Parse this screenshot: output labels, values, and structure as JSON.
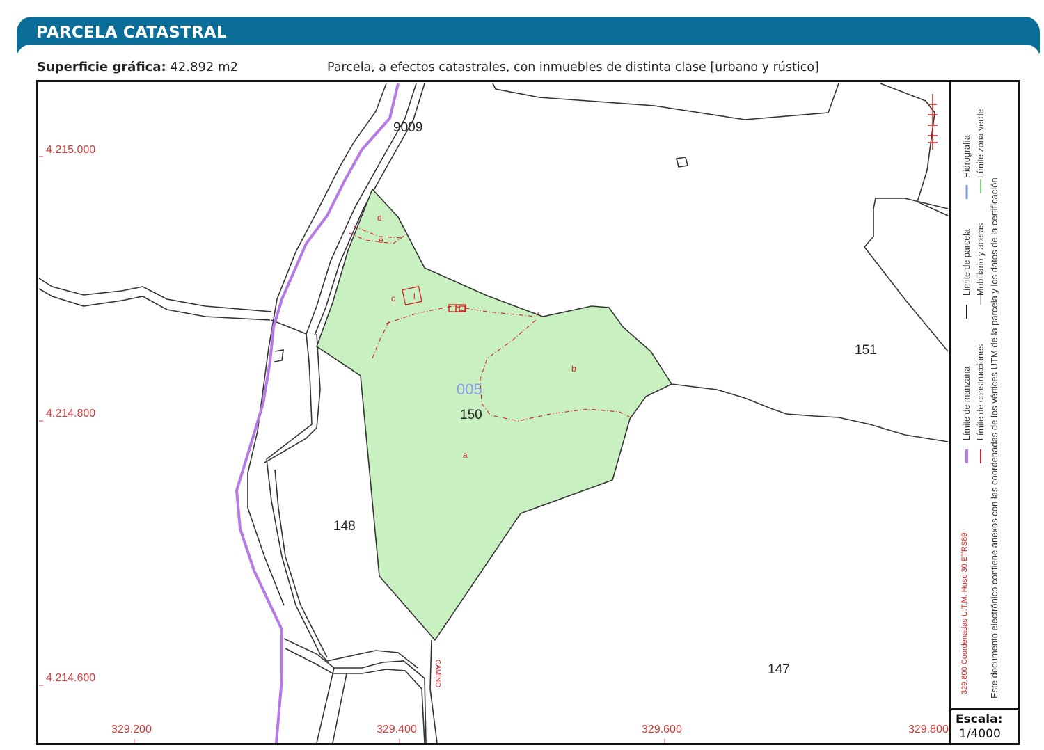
{
  "header": {
    "title": "PARCELA CATASTRAL"
  },
  "info": {
    "area_label": "Superficie gráfica:",
    "area_value": "42.892 m2",
    "description": "Parcela, a efectos catastrales, con inmuebles de distinta clase [urbano y rústico]"
  },
  "map": {
    "y_coords": [
      "4.215.000",
      "4.214.800",
      "4.214.600"
    ],
    "x_coords": [
      "329.200",
      "329.400",
      "329.600",
      "329.800"
    ],
    "parcels": {
      "main": "150",
      "west": "148",
      "south": "147",
      "east": "151",
      "road": "9009",
      "polygon": "005"
    },
    "subparcels": [
      "a",
      "b",
      "c",
      "d",
      "e"
    ],
    "construction_label": "l",
    "road_name": "CAMINO",
    "colors": {
      "parcel_fill": "#c8f0c0",
      "hydro": "#b679e8",
      "construction": "#d42020",
      "header": "#0a6e99",
      "polygon_label": "#8f9af0"
    }
  },
  "legend": {
    "items": [
      {
        "label": "Límite de manzana",
        "color": "#b679e8"
      },
      {
        "label": "Límite de construcciones",
        "color": "#d42020"
      },
      {
        "label": "Límite de parcela",
        "color": "#222222"
      },
      {
        "label": "Mobiliario y aceras",
        "color": "#bbbbbb"
      },
      {
        "label": "Hidrografía",
        "color": "#7a96d8"
      },
      {
        "label": "Límite zona verde",
        "color": "#7ad87a"
      }
    ],
    "crs_note": "329.800 Coordenadas U.T.M. Huso 30 ETRS89",
    "note_line1": "Este documento electrónico contiene anexos con las coordenadas de los vértices UTM de la parcela y los datos de la certificación"
  },
  "scale": {
    "label": "Escala:",
    "value": "1/4000"
  }
}
